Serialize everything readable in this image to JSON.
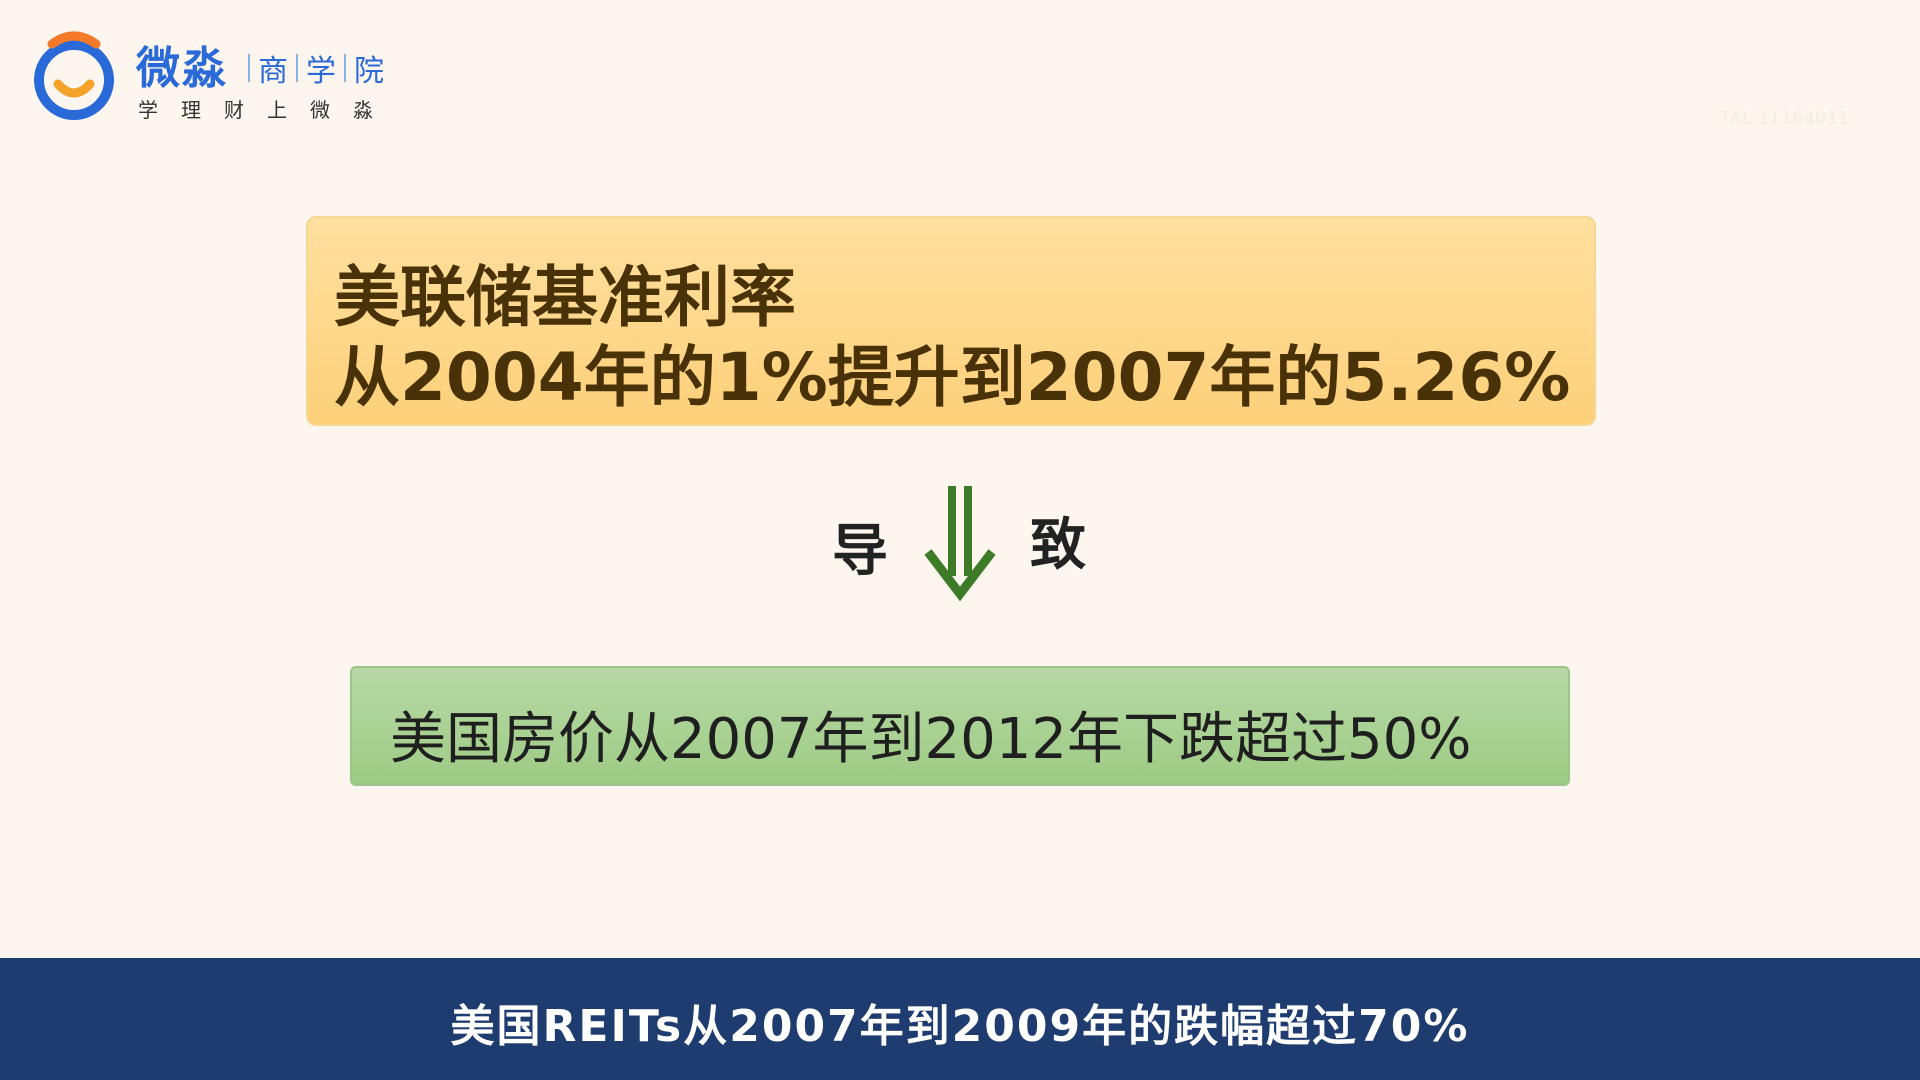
{
  "logo": {
    "brand": "微淼",
    "sub_items": [
      "商",
      "学",
      "院"
    ],
    "slogan": "学理财上微淼",
    "colors": {
      "ring": "#2a6ad8",
      "accent": "#f47a2a"
    }
  },
  "watermark": "TAL 11164011",
  "box_top": {
    "line1": "美联储基准利率",
    "line2": "从2004年的1%提升到2007年的5.26%",
    "color": "#fdd07a"
  },
  "connector": {
    "left": "导",
    "right": "致",
    "arrow_icon": "double-down-arrow-icon",
    "arrow_color": "#3d7a28"
  },
  "box_bottom": {
    "text": "美国房价从2007年到2012年下跌超过50%",
    "color": "#9dcb84"
  },
  "subtitle": {
    "text": "美国REITs从2007年到2009年的跌幅超过70%",
    "bar_color": "#1f3c70"
  }
}
